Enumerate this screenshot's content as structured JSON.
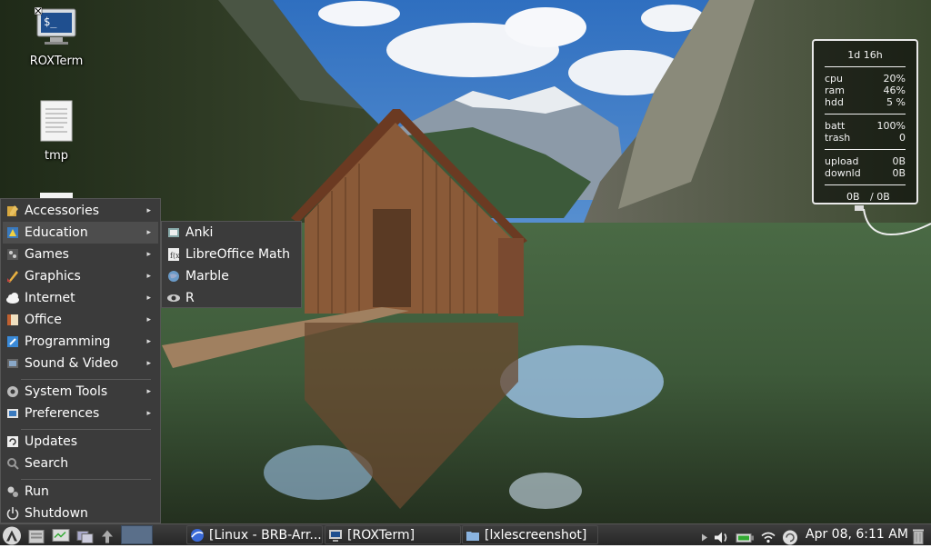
{
  "desktop": {
    "icons": [
      {
        "label": "ROXTerm",
        "icon": "terminal-icon"
      },
      {
        "label": "tmp",
        "icon": "text-file-icon"
      }
    ]
  },
  "conky": {
    "uptime": "1d 16h",
    "stats": [
      {
        "key": "cpu",
        "value": "20%"
      },
      {
        "key": "ram",
        "value": "46%"
      },
      {
        "key": "hdd",
        "value": "5 %"
      },
      {
        "key": "batt",
        "value": "100%"
      },
      {
        "key": "trash",
        "value": "0"
      },
      {
        "key": "upload",
        "value": "0B"
      },
      {
        "key": "downld",
        "value": "0B"
      }
    ],
    "totals": {
      "down": "0B",
      "up": "/ 0B"
    }
  },
  "main_menu": {
    "items": [
      {
        "label": "Accessories",
        "icon": "accessories-icon",
        "submenu": true
      },
      {
        "label": "Education",
        "icon": "education-icon",
        "submenu": true,
        "highlighted": true
      },
      {
        "label": "Games",
        "icon": "games-icon",
        "submenu": true
      },
      {
        "label": "Graphics",
        "icon": "graphics-icon",
        "submenu": true
      },
      {
        "label": "Internet",
        "icon": "internet-icon",
        "submenu": true
      },
      {
        "label": "Office",
        "icon": "office-icon",
        "submenu": true
      },
      {
        "label": "Programming",
        "icon": "programming-icon",
        "submenu": true
      },
      {
        "label": "Sound & Video",
        "icon": "sound-video-icon",
        "submenu": true
      },
      {
        "label": "System Tools",
        "icon": "system-tools-icon",
        "submenu": true
      },
      {
        "label": "Preferences",
        "icon": "preferences-icon",
        "submenu": true
      },
      {
        "label": "Updates",
        "icon": "updates-icon",
        "submenu": false
      },
      {
        "label": "Search",
        "icon": "search-icon",
        "submenu": false
      },
      {
        "label": "Run",
        "icon": "run-icon",
        "submenu": false
      },
      {
        "label": "Shutdown",
        "icon": "shutdown-icon",
        "submenu": false
      }
    ]
  },
  "education_submenu": {
    "items": [
      {
        "label": "Anki",
        "icon": "anki-icon"
      },
      {
        "label": "LibreOffice Math",
        "icon": "libreoffice-math-icon"
      },
      {
        "label": "Marble",
        "icon": "marble-globe-icon"
      },
      {
        "label": "R",
        "icon": "r-eye-icon"
      }
    ]
  },
  "taskbar": {
    "tasks": [
      {
        "label": "[Linux - BRB-Arr...",
        "icon": "browser-icon"
      },
      {
        "label": "[ROXTerm]",
        "icon": "terminal-icon"
      },
      {
        "label": "[lxlescreenshot]",
        "icon": "folder-icon"
      }
    ],
    "clock": "Apr 08,  6:11 AM"
  },
  "colors": {
    "menu_bg": "#3b3b3b",
    "menu_highlight": "#4d4d4d",
    "taskbar_bg": "#2e2e2e",
    "sky": "#3a7cc7"
  }
}
